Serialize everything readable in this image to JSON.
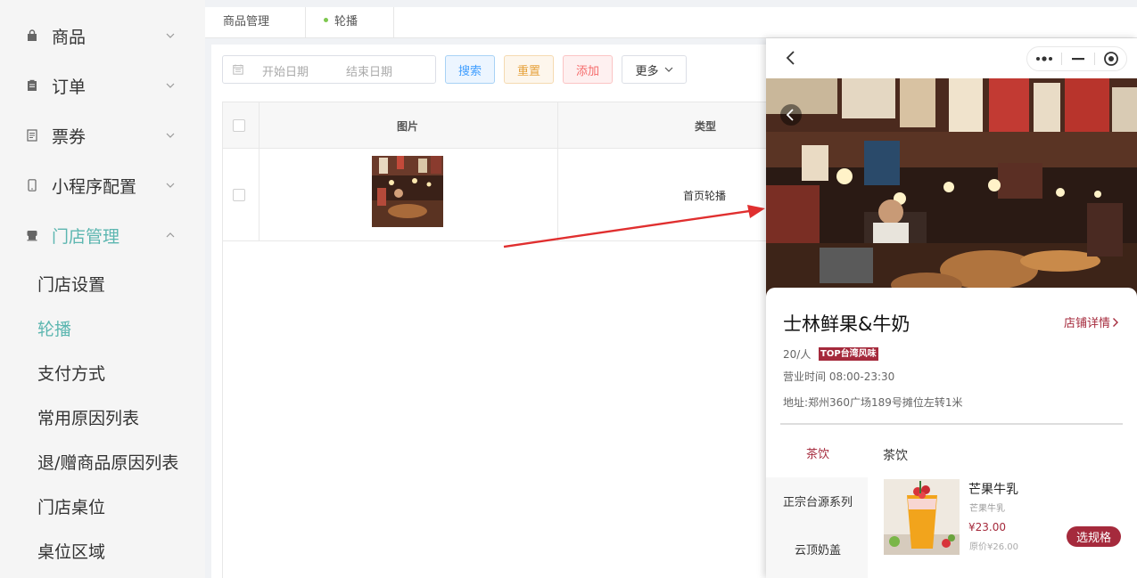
{
  "sidebar": {
    "items": [
      {
        "label": "商品",
        "icon": "bag-icon"
      },
      {
        "label": "订单",
        "icon": "clipboard-icon"
      },
      {
        "label": "票券",
        "icon": "document-icon"
      },
      {
        "label": "小程序配置",
        "icon": "mobile-icon"
      },
      {
        "label": "门店管理",
        "icon": "store-icon",
        "expanded": true
      }
    ],
    "subitems": [
      {
        "label": "门店设置"
      },
      {
        "label": "轮播",
        "active": true
      },
      {
        "label": "支付方式"
      },
      {
        "label": "常用原因列表"
      },
      {
        "label": "退/赠商品原因列表"
      },
      {
        "label": "门店桌位"
      },
      {
        "label": "桌位区域"
      }
    ],
    "active_color": "#5cb6b0"
  },
  "tabs": [
    {
      "label": "商品管理"
    },
    {
      "label": "轮播",
      "active": true
    }
  ],
  "toolbar": {
    "start_placeholder": "开始日期",
    "end_placeholder": "结束日期",
    "search_label": "搜索",
    "reset_label": "重置",
    "add_label": "添加",
    "more_label": "更多"
  },
  "table": {
    "columns": [
      "图片",
      "类型"
    ],
    "rows": [
      {
        "type": "首页轮播"
      }
    ]
  },
  "phone": {
    "shop_name": "士林鲜果&牛奶",
    "shop_detail": "店铺详情",
    "per_person": "20/人",
    "tag": "TOP台湾风味",
    "hours": "营业时间 08:00-23:30",
    "address": "地址:郑州360广场189号摊位左转1米",
    "categories": [
      "茶饮",
      "正宗台源系列",
      "云顶奶盖"
    ],
    "section_title": "茶饮",
    "product": {
      "name": "芒果牛乳",
      "desc": "芒果牛乳",
      "price": "¥23.00",
      "orig": "原价¥26.00",
      "button": "选规格"
    },
    "brand_color": "#a52a3c"
  }
}
